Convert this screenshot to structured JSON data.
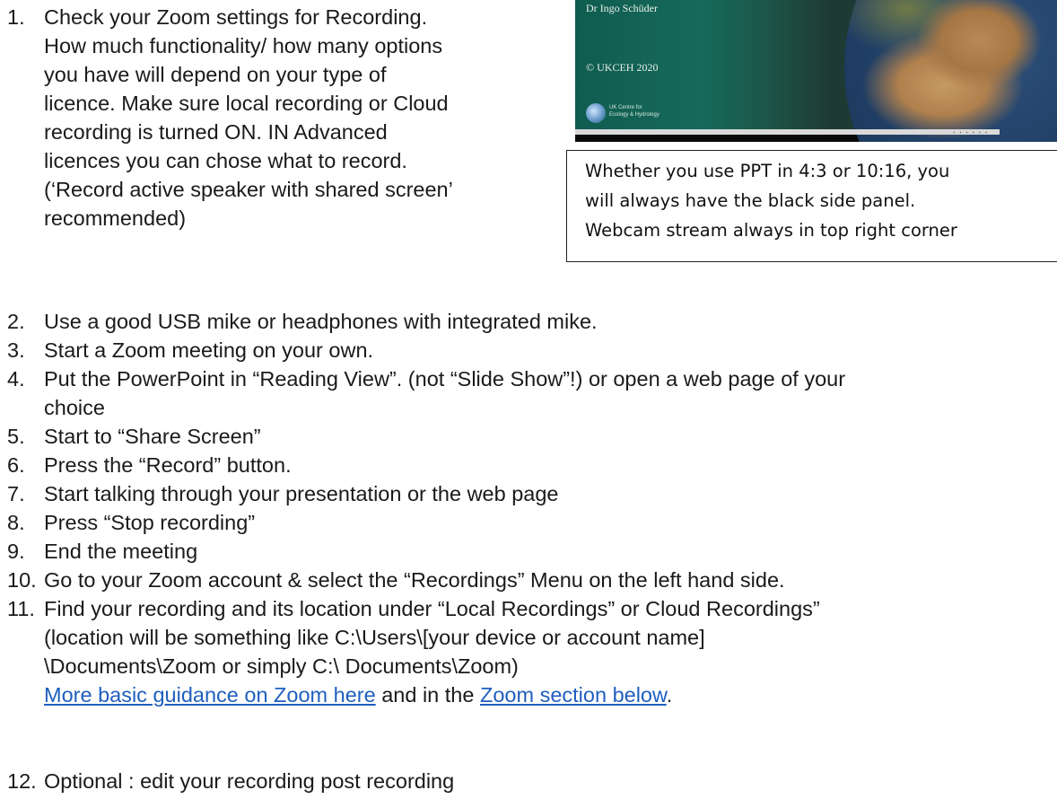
{
  "thumbnail": {
    "name_line": "Dr Ingo Schüder",
    "copyright": "© UKCEH 2020",
    "logo_text": [
      "UK Centre for",
      "Ecology & Hydrology"
    ]
  },
  "caption_lines": [
    "Whether you use PPT in 4:3 or 10:16, you",
    "will always have the black side panel.",
    "Webcam stream always in top right corner"
  ],
  "steps": [
    {
      "num": "1.",
      "lines": [
        "Check your Zoom settings for Recording.",
        "How much functionality/ how many options",
        "you have will depend on your type of",
        "licence. Make sure local recording or Cloud",
        "recording is turned ON.  IN Advanced",
        "licences you can chose what to record.",
        "(‘Record active speaker with shared screen’",
        "recommended)"
      ]
    },
    {
      "num": "2.",
      "lines": [
        "Use a good USB mike or headphones with integrated mike."
      ]
    },
    {
      "num": "3.",
      "lines": [
        "Start a Zoom meeting on your own."
      ]
    },
    {
      "num": "4.",
      "lines": [
        "Put the PowerPoint in “Reading View”. (not “Slide Show”!) or open a web page of your",
        "choice"
      ]
    },
    {
      "num": "5.",
      "lines": [
        "Start to “Share Screen”"
      ]
    },
    {
      "num": "6.",
      "lines": [
        "Press the “Record” button."
      ]
    },
    {
      "num": "7.",
      "lines": [
        "Start talking through your presentation or the web page"
      ]
    },
    {
      "num": "8.",
      "lines": [
        "Press “Stop recording”"
      ]
    },
    {
      "num": "9.",
      "lines": [
        "End the meeting"
      ]
    },
    {
      "num": "10.",
      "lines": [
        "Go to your Zoom account & select the “Recordings” Menu on the left hand side."
      ]
    },
    {
      "num": "11.",
      "lines": [
        "Find your recording and its location under “Local Recordings” or Cloud Recordings”",
        "(location will be something like C:\\Users\\[your device or account name]",
        "\\Documents\\Zoom or simply C:\\ Documents\\Zoom)"
      ],
      "link1": "More basic guidance on Zoom here",
      "mid": " and in the ",
      "link2": "Zoom section below",
      "end": "."
    },
    {
      "num": "12.",
      "lines": [
        "Optional : edit your recording post recording"
      ]
    }
  ]
}
